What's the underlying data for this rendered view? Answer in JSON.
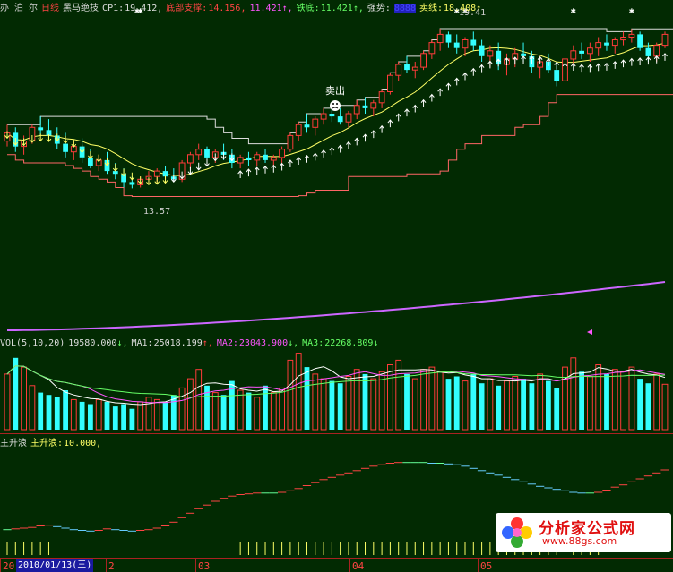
{
  "header": {
    "left_trunc": "办 泊 尔",
    "period": "日线",
    "indicator": "黑马绝技",
    "cp1_label": "CP1:",
    "cp1_value": "19.412,",
    "support_label": "底部支撑:",
    "support_value1": "14.156,",
    "support_value2": "11.421",
    "iron_label": "铁底:",
    "iron_value": "11.421",
    "strength_label": "强势:",
    "strength_box": "8888",
    "sell_label": "卖线:",
    "sell_value": "18.408"
  },
  "annotations": {
    "sell_point": "卖出",
    "high_label": "19.41",
    "low_label": "13.57"
  },
  "vol_header": {
    "name": "VOL(5,10,20)",
    "vol": "19580.000",
    "ma1_label": "MA1:",
    "ma1": "25018.199",
    "ma2_label": "MA2:",
    "ma2": "23043.900",
    "ma3_label": "MA3:",
    "ma3": "22268.809"
  },
  "wave_header": {
    "name": "主升浪",
    "label": "主升浪:",
    "value": "10.000,"
  },
  "axis": {
    "cursor_date": "2010/01/13(三)",
    "months": [
      "20",
      "2",
      "03",
      "04",
      "05"
    ]
  },
  "watermark": {
    "title": "分析家公式网",
    "url": "www.88gs.com"
  },
  "colors": {
    "bg": "#022a02",
    "up": "#ff3b3b",
    "down": "#33ffff",
    "ma_yellow": "#ffff66",
    "ma_magenta": "#ff55ff",
    "ma_green": "#66ff66",
    "ma_white": "#ffffff",
    "line_purple": "#cc66ff",
    "wave_cyan": "#66ccff",
    "wave_red": "#ff4444",
    "wave_green": "#66ff99"
  },
  "chart_data": {
    "type": "candlestick",
    "price_range": [
      12.6,
      20.0
    ],
    "candles": [
      [
        15.3,
        15.9,
        15.1,
        15.6
      ],
      [
        15.6,
        15.8,
        14.9,
        15.1
      ],
      [
        15.1,
        15.5,
        14.8,
        15.3
      ],
      [
        15.3,
        15.9,
        15.2,
        15.8
      ],
      [
        15.8,
        16.2,
        15.5,
        15.7
      ],
      [
        15.7,
        16.1,
        15.3,
        15.5
      ],
      [
        15.5,
        15.8,
        15.0,
        15.2
      ],
      [
        15.2,
        15.6,
        14.7,
        14.9
      ],
      [
        14.9,
        15.3,
        14.6,
        15.1
      ],
      [
        15.1,
        15.4,
        14.5,
        14.7
      ],
      [
        14.7,
        15.0,
        14.3,
        14.4
      ],
      [
        14.4,
        14.8,
        14.2,
        14.6
      ],
      [
        14.6,
        14.9,
        14.1,
        14.2
      ],
      [
        14.2,
        14.5,
        13.9,
        14.1
      ],
      [
        14.1,
        14.3,
        13.6,
        13.8
      ],
      [
        13.8,
        14.0,
        13.57,
        13.7
      ],
      [
        13.7,
        14.0,
        13.6,
        13.9
      ],
      [
        13.9,
        14.2,
        13.7,
        14.0
      ],
      [
        14.0,
        14.3,
        13.8,
        14.2
      ],
      [
        14.2,
        14.4,
        13.9,
        14.0
      ],
      [
        14.0,
        14.3,
        13.8,
        13.9
      ],
      [
        13.9,
        14.6,
        13.8,
        14.5
      ],
      [
        14.5,
        14.9,
        14.3,
        14.8
      ],
      [
        14.8,
        15.2,
        14.6,
        15.0
      ],
      [
        15.0,
        15.1,
        14.5,
        14.7
      ],
      [
        14.7,
        15.0,
        14.5,
        14.9
      ],
      [
        14.9,
        15.2,
        14.6,
        14.8
      ],
      [
        14.8,
        15.0,
        14.3,
        14.5
      ],
      [
        14.5,
        14.8,
        14.3,
        14.7
      ],
      [
        14.7,
        14.9,
        14.4,
        14.6
      ],
      [
        14.6,
        14.9,
        14.4,
        14.8
      ],
      [
        14.8,
        15.0,
        14.5,
        14.6
      ],
      [
        14.6,
        14.8,
        14.4,
        14.7
      ],
      [
        14.7,
        15.1,
        14.5,
        15.0
      ],
      [
        15.0,
        15.6,
        14.9,
        15.5
      ],
      [
        15.5,
        16.0,
        15.3,
        15.9
      ],
      [
        15.9,
        16.3,
        15.6,
        15.8
      ],
      [
        15.8,
        16.2,
        15.5,
        16.1
      ],
      [
        16.1,
        16.5,
        15.9,
        16.3
      ],
      [
        16.3,
        16.6,
        16.0,
        16.2
      ],
      [
        16.2,
        16.5,
        15.9,
        16.0
      ],
      [
        16.0,
        16.4,
        15.8,
        16.3
      ],
      [
        16.3,
        16.8,
        16.1,
        16.6
      ],
      [
        16.6,
        16.9,
        16.3,
        16.5
      ],
      [
        16.5,
        16.8,
        16.2,
        16.7
      ],
      [
        16.7,
        17.2,
        16.5,
        17.1
      ],
      [
        17.1,
        17.8,
        17.0,
        17.7
      ],
      [
        17.7,
        18.2,
        17.5,
        18.1
      ],
      [
        18.1,
        18.4,
        17.8,
        17.9
      ],
      [
        17.9,
        18.2,
        17.6,
        18.0
      ],
      [
        18.0,
        18.6,
        17.9,
        18.5
      ],
      [
        18.5,
        19.0,
        18.3,
        18.9
      ],
      [
        18.9,
        19.41,
        18.6,
        19.2
      ],
      [
        19.2,
        19.3,
        18.7,
        18.9
      ],
      [
        18.9,
        19.2,
        18.5,
        18.7
      ],
      [
        18.7,
        19.1,
        18.4,
        19.0
      ],
      [
        19.0,
        19.3,
        18.6,
        18.8
      ],
      [
        18.8,
        19.0,
        18.2,
        18.4
      ],
      [
        18.4,
        18.8,
        18.0,
        18.6
      ],
      [
        18.6,
        18.9,
        17.9,
        18.1
      ],
      [
        18.1,
        18.5,
        17.7,
        18.3
      ],
      [
        18.3,
        18.7,
        18.0,
        18.5
      ],
      [
        18.5,
        18.9,
        18.2,
        18.4
      ],
      [
        18.4,
        18.6,
        17.8,
        18.0
      ],
      [
        18.0,
        18.4,
        17.6,
        18.2
      ],
      [
        18.2,
        18.5,
        17.8,
        17.9
      ],
      [
        17.9,
        18.2,
        17.3,
        17.5
      ],
      [
        17.5,
        18.4,
        17.4,
        18.3
      ],
      [
        18.3,
        18.8,
        18.1,
        18.6
      ],
      [
        18.6,
        18.9,
        18.3,
        18.5
      ],
      [
        18.5,
        18.9,
        18.2,
        18.7
      ],
      [
        18.7,
        19.1,
        18.4,
        18.9
      ],
      [
        18.9,
        19.2,
        18.6,
        18.8
      ],
      [
        18.8,
        19.1,
        18.5,
        19.0
      ],
      [
        19.0,
        19.3,
        18.8,
        19.1
      ],
      [
        19.1,
        19.4,
        18.9,
        19.2
      ],
      [
        19.2,
        19.3,
        18.6,
        18.7
      ],
      [
        18.7,
        18.9,
        18.2,
        18.4
      ],
      [
        18.4,
        18.9,
        18.2,
        18.8
      ],
      [
        18.8,
        19.3,
        18.7,
        19.2
      ]
    ],
    "volumes": [
      24000,
      31000,
      27000,
      19000,
      16000,
      15000,
      14000,
      17000,
      13000,
      12000,
      11000,
      13000,
      12000,
      10000,
      11000,
      9000,
      12000,
      14000,
      13000,
      12000,
      15000,
      18000,
      22000,
      26000,
      19000,
      16000,
      15000,
      21000,
      17000,
      16000,
      14000,
      19000,
      16000,
      18000,
      30000,
      33000,
      27000,
      24000,
      22000,
      21000,
      20000,
      23000,
      26000,
      24000,
      22000,
      25000,
      28000,
      30000,
      24000,
      22000,
      26000,
      27000,
      25000,
      22000,
      23000,
      21000,
      24000,
      20000,
      22000,
      19000,
      21000,
      23000,
      22000,
      20000,
      24000,
      21000,
      18000,
      27000,
      31000,
      25000,
      23000,
      28000,
      24000,
      26000,
      25000,
      27000,
      22000,
      20000,
      24000,
      19580
    ],
    "volume_max": 34000,
    "wave": [
      1.0,
      1.1,
      1.2,
      1.3,
      1.5,
      1.6,
      1.4,
      1.2,
      1.0,
      0.9,
      0.8,
      0.9,
      1.1,
      1.0,
      0.9,
      0.8,
      0.9,
      1.0,
      1.2,
      1.5,
      2.0,
      2.6,
      3.2,
      3.8,
      4.3,
      4.8,
      5.2,
      5.5,
      5.7,
      5.8,
      5.9,
      5.9,
      5.9,
      6.0,
      6.2,
      6.5,
      6.9,
      7.3,
      7.7,
      8.0,
      8.3,
      8.6,
      8.9,
      9.2,
      9.5,
      9.7,
      9.9,
      10.0,
      10.0,
      10.0,
      10.0,
      9.9,
      9.9,
      9.8,
      9.7,
      9.5,
      9.2,
      8.9,
      8.6,
      8.3,
      8.0,
      7.7,
      7.4,
      7.1,
      6.8,
      6.6,
      6.4,
      6.2,
      6.0,
      5.9,
      5.9,
      6.0,
      6.3,
      6.7,
      7.0,
      7.4,
      7.8,
      8.2,
      8.6,
      9.0
    ],
    "wave_max": 12
  }
}
